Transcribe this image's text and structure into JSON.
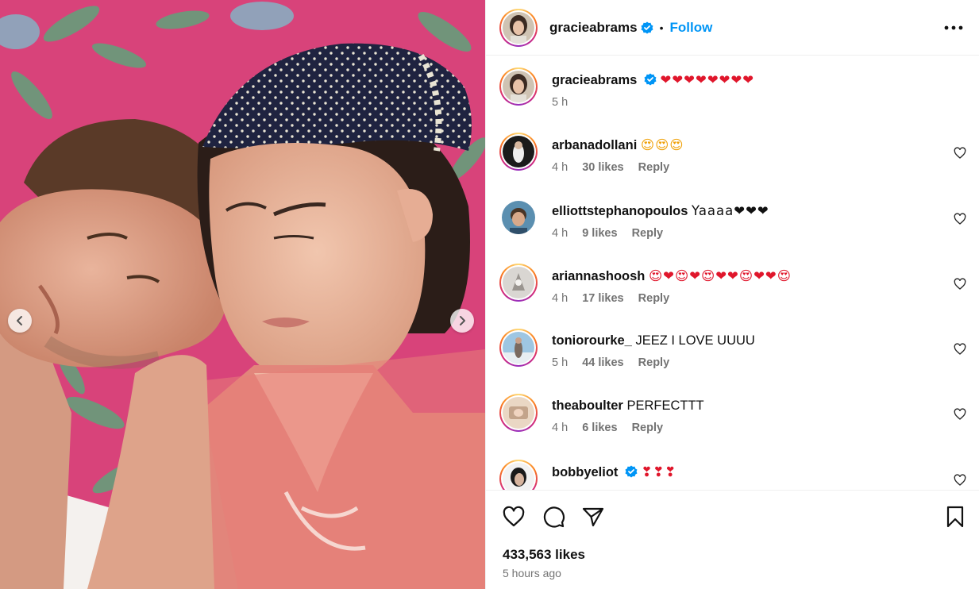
{
  "post": {
    "author": "gracieabrams",
    "follow_label": "Follow",
    "dot": "•",
    "caption": "❤❤❤❤❤❤❤❤",
    "caption_time": "5 h",
    "likes": "433,563 likes",
    "posted": "5 hours ago"
  },
  "comments": [
    {
      "user": "arbanadollani",
      "text": "😍😍😍",
      "time": "4 h",
      "likes": "30 likes",
      "reply": "Reply"
    },
    {
      "user": "elliottstephanopoulos",
      "text": "Yaaaa❤❤❤",
      "time": "4 h",
      "likes": "9 likes",
      "reply": "Reply"
    },
    {
      "user": "ariannashoosh",
      "text": "😍❤😍❤😍❤❤😍❤❤😍",
      "time": "4 h",
      "likes": "17 likes",
      "reply": "Reply"
    },
    {
      "user": "toniorourke_",
      "text": "JEEZ I LOVE UUUU",
      "time": "5 h",
      "likes": "44 likes",
      "reply": "Reply"
    },
    {
      "user": "theaboulter",
      "text": "PERFECTTT",
      "time": "4 h",
      "likes": "6 likes",
      "reply": "Reply"
    },
    {
      "user": "bobbyeliot",
      "text": "❣❣❣",
      "time": "",
      "likes": "",
      "reply": ""
    }
  ],
  "colors": {
    "follow_blue": "#0095f6",
    "verified_blue": "#0095f6",
    "muted_text": "#737373",
    "heart_red": "#e0162b"
  },
  "icons": [
    "chevron-left-icon",
    "chevron-right-icon",
    "more-options-icon",
    "verified-badge-icon",
    "heart-outline-icon",
    "comment-icon",
    "share-icon",
    "bookmark-icon"
  ]
}
